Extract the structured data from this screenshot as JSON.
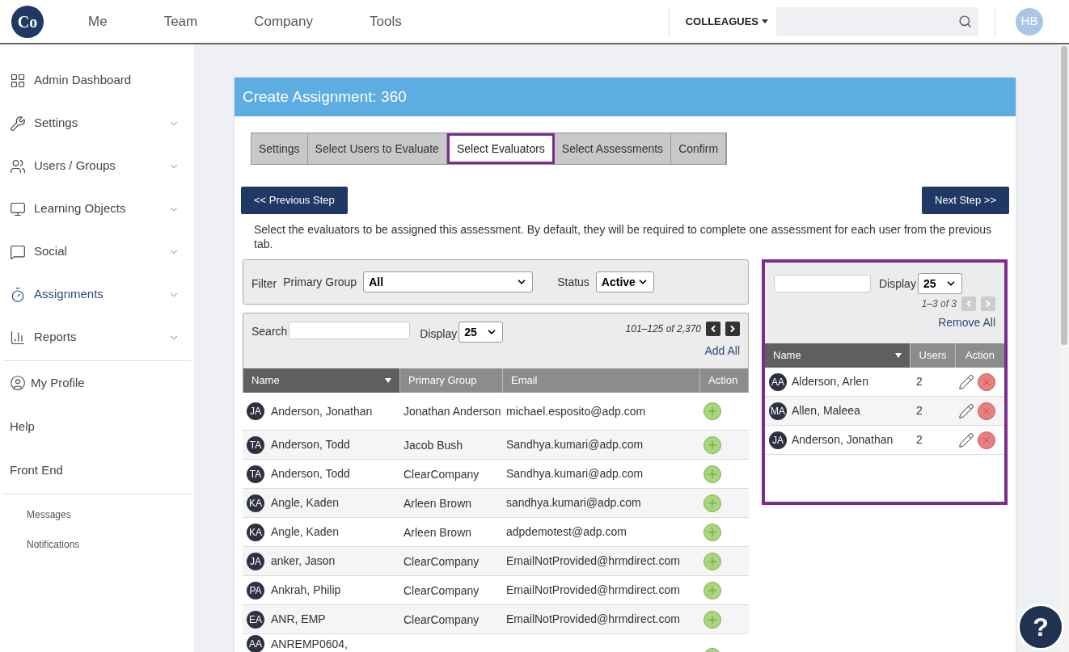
{
  "topbar": {
    "logo": "Co",
    "nav": [
      "Me",
      "Team",
      "Company",
      "Tools"
    ],
    "scope": "COLLEAGUES",
    "avatar": "HB"
  },
  "sidebar": {
    "items": [
      {
        "label": "Admin Dashboard",
        "expandable": false,
        "selected": false
      },
      {
        "label": "Settings",
        "expandable": true,
        "selected": false
      },
      {
        "label": "Users / Groups",
        "expandable": true,
        "selected": false
      },
      {
        "label": "Learning Objects",
        "expandable": true,
        "selected": false
      },
      {
        "label": "Social",
        "expandable": true,
        "selected": false
      },
      {
        "label": "Assignments",
        "expandable": true,
        "selected": true
      },
      {
        "label": "Reports",
        "expandable": true,
        "selected": false
      }
    ],
    "links": [
      "My Profile",
      "Help",
      "Front End"
    ],
    "small_links": [
      "Messages",
      "Notifications"
    ]
  },
  "card": {
    "title": "Create Assignment: 360",
    "steps": [
      {
        "label": "Settings",
        "selected": false
      },
      {
        "label": "Select Users to Evaluate",
        "selected": false
      },
      {
        "label": "Select Evaluators",
        "selected": true
      },
      {
        "label": "Select Assessments",
        "selected": false
      },
      {
        "label": "Confirm",
        "selected": false
      }
    ],
    "prev_button": "<< Previous Step",
    "next_button": "Next Step >>",
    "description": "Select the evaluators to be assigned this assessment. By default, they will be required to complete one assessment for each user from the previous tab.",
    "filter": {
      "label": "Filter",
      "group_label": "Primary Group",
      "group_value": "All",
      "status_label": "Status",
      "status_value": "Active"
    },
    "available": {
      "search_label": "Search",
      "display_label": "Display",
      "display_value": "25",
      "range": "101–125 of 2,370",
      "add_all": "Add All",
      "columns": [
        "Name",
        "Primary Group",
        "Email",
        "Action"
      ],
      "rows": [
        {
          "initials": "JA",
          "name": "Anderson, Jonathan",
          "group": "Jonathan Anderson",
          "email": "michael.esposito@adp.com"
        },
        {
          "initials": "TA",
          "name": "Anderson, Todd",
          "group": "Jacob Bush",
          "email": "Sandhya.kumari@adp.com"
        },
        {
          "initials": "TA",
          "name": "Anderson, Todd",
          "group": "ClearCompany",
          "email": "Sandhya.kumari@adp.com"
        },
        {
          "initials": "KA",
          "name": "Angle, Kaden",
          "group": "Arleen Brown",
          "email": "sandhya.kumari@adp.com"
        },
        {
          "initials": "KA",
          "name": "Angle, Kaden",
          "group": "Arleen Brown",
          "email": "adpdemotest@adp.com"
        },
        {
          "initials": "JA",
          "name": "anker, Jason",
          "group": "ClearCompany",
          "email": "EmailNotProvided@hrmdirect.com"
        },
        {
          "initials": "PA",
          "name": "Ankrah, Philip",
          "group": "ClearCompany",
          "email": "EmailNotProvided@hrmdirect.com"
        },
        {
          "initials": "EA",
          "name": "ANR, EMP",
          "group": "ClearCompany",
          "email": "EmailNotProvided@hrmdirect.com"
        },
        {
          "initials": "AA",
          "name": "ANREMP0604,"
        }
      ]
    },
    "selected_panel": {
      "display_label": "Display",
      "display_value": "25",
      "range": "1–3 of 3",
      "remove_all": "Remove All",
      "columns": [
        "Name",
        "Users",
        "Action"
      ],
      "rows": [
        {
          "initials": "AA",
          "name": "Alderson, Arlen",
          "users": "2"
        },
        {
          "initials": "MA",
          "name": "Allen, Maleea",
          "users": "2"
        },
        {
          "initials": "JA",
          "name": "Anderson, Jonathan",
          "users": "2"
        }
      ]
    }
  },
  "help_button": "?"
}
